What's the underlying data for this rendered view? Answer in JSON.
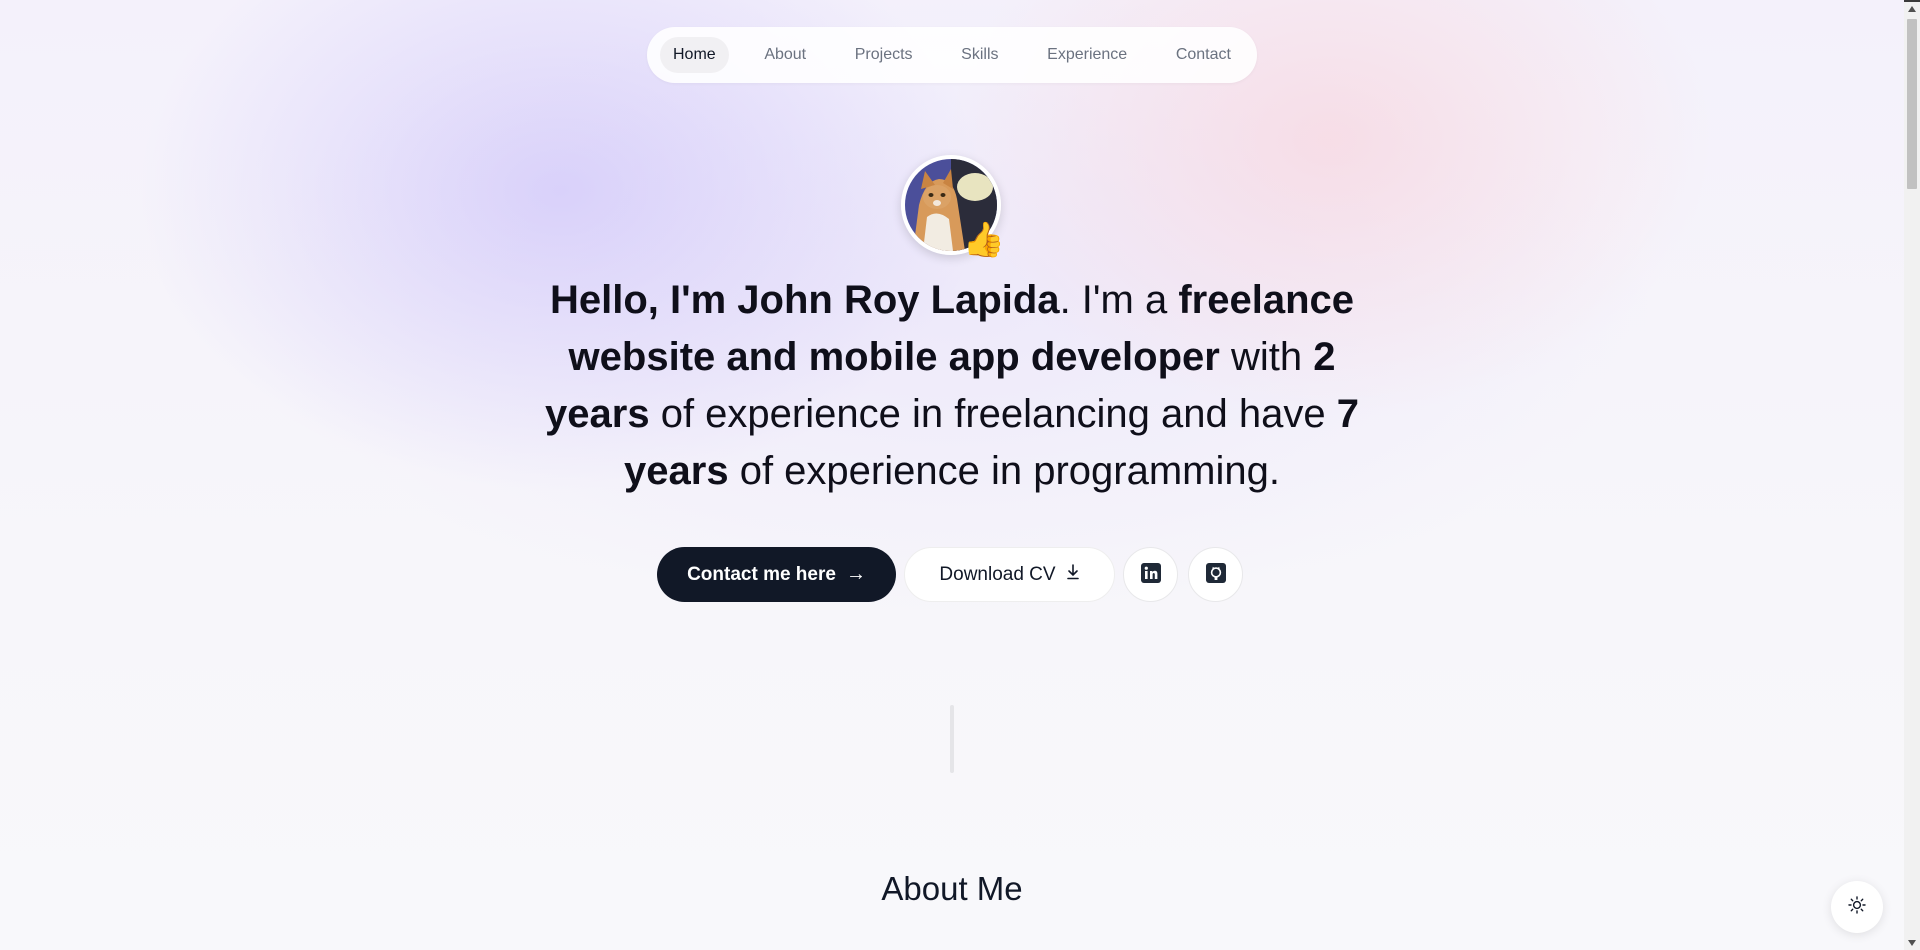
{
  "nav": {
    "items": [
      {
        "label": "Home",
        "active": true
      },
      {
        "label": "About",
        "active": false
      },
      {
        "label": "Projects",
        "active": false
      },
      {
        "label": "Skills",
        "active": false
      },
      {
        "label": "Experience",
        "active": false
      },
      {
        "label": "Contact",
        "active": false
      }
    ]
  },
  "hero": {
    "avatar_emoji": "👍",
    "segments": [
      {
        "text": "Hello, I'm John Roy Lapida",
        "bold": true
      },
      {
        "text": ". I'm a ",
        "bold": false
      },
      {
        "text": "freelance website and mobile app developer",
        "bold": true
      },
      {
        "text": " with ",
        "bold": false
      },
      {
        "text": "2 years",
        "bold": true
      },
      {
        "text": " of experience in freelancing and have ",
        "bold": false
      },
      {
        "text": "7 years",
        "bold": true
      },
      {
        "text": " of experience in programming.",
        "bold": false
      }
    ]
  },
  "actions": {
    "contact_label": "Contact me here",
    "contact_arrow": "→",
    "cv_label": "Download CV",
    "linkedin_icon": "linkedin-icon",
    "github_icon": "github-icon"
  },
  "about": {
    "title": "About Me"
  },
  "theme_toggle": {
    "icon": "sun-icon"
  },
  "colors": {
    "primary_button": "#111827",
    "text": "#0f0f1a",
    "nav_active_bg": "#f1f0f3"
  }
}
